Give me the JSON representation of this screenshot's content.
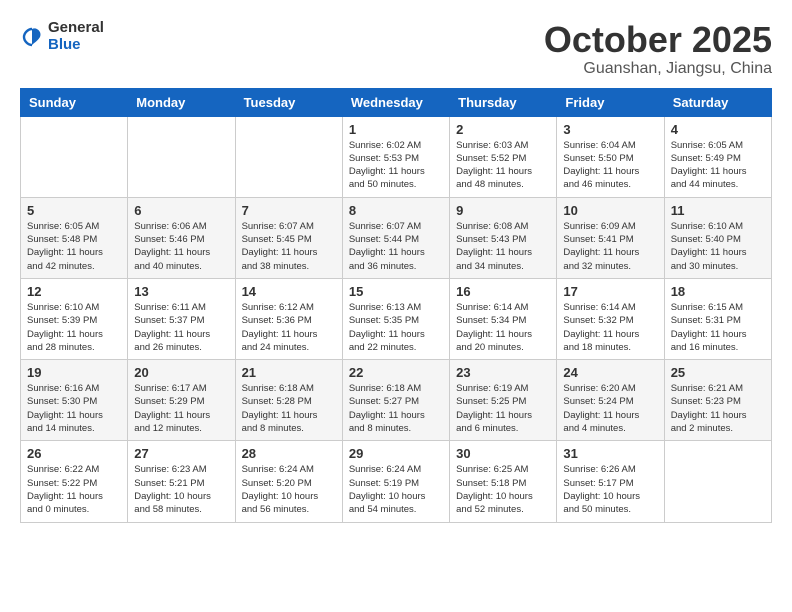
{
  "logo": {
    "general": "General",
    "blue": "Blue"
  },
  "title": "October 2025",
  "location": "Guanshan, Jiangsu, China",
  "headers": [
    "Sunday",
    "Monday",
    "Tuesday",
    "Wednesday",
    "Thursday",
    "Friday",
    "Saturday"
  ],
  "weeks": [
    [
      {
        "day": "",
        "sunrise": "",
        "sunset": "",
        "daylight": ""
      },
      {
        "day": "",
        "sunrise": "",
        "sunset": "",
        "daylight": ""
      },
      {
        "day": "",
        "sunrise": "",
        "sunset": "",
        "daylight": ""
      },
      {
        "day": "1",
        "sunrise": "Sunrise: 6:02 AM",
        "sunset": "Sunset: 5:53 PM",
        "daylight": "Daylight: 11 hours and 50 minutes."
      },
      {
        "day": "2",
        "sunrise": "Sunrise: 6:03 AM",
        "sunset": "Sunset: 5:52 PM",
        "daylight": "Daylight: 11 hours and 48 minutes."
      },
      {
        "day": "3",
        "sunrise": "Sunrise: 6:04 AM",
        "sunset": "Sunset: 5:50 PM",
        "daylight": "Daylight: 11 hours and 46 minutes."
      },
      {
        "day": "4",
        "sunrise": "Sunrise: 6:05 AM",
        "sunset": "Sunset: 5:49 PM",
        "daylight": "Daylight: 11 hours and 44 minutes."
      }
    ],
    [
      {
        "day": "5",
        "sunrise": "Sunrise: 6:05 AM",
        "sunset": "Sunset: 5:48 PM",
        "daylight": "Daylight: 11 hours and 42 minutes."
      },
      {
        "day": "6",
        "sunrise": "Sunrise: 6:06 AM",
        "sunset": "Sunset: 5:46 PM",
        "daylight": "Daylight: 11 hours and 40 minutes."
      },
      {
        "day": "7",
        "sunrise": "Sunrise: 6:07 AM",
        "sunset": "Sunset: 5:45 PM",
        "daylight": "Daylight: 11 hours and 38 minutes."
      },
      {
        "day": "8",
        "sunrise": "Sunrise: 6:07 AM",
        "sunset": "Sunset: 5:44 PM",
        "daylight": "Daylight: 11 hours and 36 minutes."
      },
      {
        "day": "9",
        "sunrise": "Sunrise: 6:08 AM",
        "sunset": "Sunset: 5:43 PM",
        "daylight": "Daylight: 11 hours and 34 minutes."
      },
      {
        "day": "10",
        "sunrise": "Sunrise: 6:09 AM",
        "sunset": "Sunset: 5:41 PM",
        "daylight": "Daylight: 11 hours and 32 minutes."
      },
      {
        "day": "11",
        "sunrise": "Sunrise: 6:10 AM",
        "sunset": "Sunset: 5:40 PM",
        "daylight": "Daylight: 11 hours and 30 minutes."
      }
    ],
    [
      {
        "day": "12",
        "sunrise": "Sunrise: 6:10 AM",
        "sunset": "Sunset: 5:39 PM",
        "daylight": "Daylight: 11 hours and 28 minutes."
      },
      {
        "day": "13",
        "sunrise": "Sunrise: 6:11 AM",
        "sunset": "Sunset: 5:37 PM",
        "daylight": "Daylight: 11 hours and 26 minutes."
      },
      {
        "day": "14",
        "sunrise": "Sunrise: 6:12 AM",
        "sunset": "Sunset: 5:36 PM",
        "daylight": "Daylight: 11 hours and 24 minutes."
      },
      {
        "day": "15",
        "sunrise": "Sunrise: 6:13 AM",
        "sunset": "Sunset: 5:35 PM",
        "daylight": "Daylight: 11 hours and 22 minutes."
      },
      {
        "day": "16",
        "sunrise": "Sunrise: 6:14 AM",
        "sunset": "Sunset: 5:34 PM",
        "daylight": "Daylight: 11 hours and 20 minutes."
      },
      {
        "day": "17",
        "sunrise": "Sunrise: 6:14 AM",
        "sunset": "Sunset: 5:32 PM",
        "daylight": "Daylight: 11 hours and 18 minutes."
      },
      {
        "day": "18",
        "sunrise": "Sunrise: 6:15 AM",
        "sunset": "Sunset: 5:31 PM",
        "daylight": "Daylight: 11 hours and 16 minutes."
      }
    ],
    [
      {
        "day": "19",
        "sunrise": "Sunrise: 6:16 AM",
        "sunset": "Sunset: 5:30 PM",
        "daylight": "Daylight: 11 hours and 14 minutes."
      },
      {
        "day": "20",
        "sunrise": "Sunrise: 6:17 AM",
        "sunset": "Sunset: 5:29 PM",
        "daylight": "Daylight: 11 hours and 12 minutes."
      },
      {
        "day": "21",
        "sunrise": "Sunrise: 6:18 AM",
        "sunset": "Sunset: 5:28 PM",
        "daylight": "Daylight: 11 hours and 8 minutes."
      },
      {
        "day": "22",
        "sunrise": "Sunrise: 6:18 AM",
        "sunset": "Sunset: 5:27 PM",
        "daylight": "Daylight: 11 hours and 8 minutes."
      },
      {
        "day": "23",
        "sunrise": "Sunrise: 6:19 AM",
        "sunset": "Sunset: 5:25 PM",
        "daylight": "Daylight: 11 hours and 6 minutes."
      },
      {
        "day": "24",
        "sunrise": "Sunrise: 6:20 AM",
        "sunset": "Sunset: 5:24 PM",
        "daylight": "Daylight: 11 hours and 4 minutes."
      },
      {
        "day": "25",
        "sunrise": "Sunrise: 6:21 AM",
        "sunset": "Sunset: 5:23 PM",
        "daylight": "Daylight: 11 hours and 2 minutes."
      }
    ],
    [
      {
        "day": "26",
        "sunrise": "Sunrise: 6:22 AM",
        "sunset": "Sunset: 5:22 PM",
        "daylight": "Daylight: 11 hours and 0 minutes."
      },
      {
        "day": "27",
        "sunrise": "Sunrise: 6:23 AM",
        "sunset": "Sunset: 5:21 PM",
        "daylight": "Daylight: 10 hours and 58 minutes."
      },
      {
        "day": "28",
        "sunrise": "Sunrise: 6:24 AM",
        "sunset": "Sunset: 5:20 PM",
        "daylight": "Daylight: 10 hours and 56 minutes."
      },
      {
        "day": "29",
        "sunrise": "Sunrise: 6:24 AM",
        "sunset": "Sunset: 5:19 PM",
        "daylight": "Daylight: 10 hours and 54 minutes."
      },
      {
        "day": "30",
        "sunrise": "Sunrise: 6:25 AM",
        "sunset": "Sunset: 5:18 PM",
        "daylight": "Daylight: 10 hours and 52 minutes."
      },
      {
        "day": "31",
        "sunrise": "Sunrise: 6:26 AM",
        "sunset": "Sunset: 5:17 PM",
        "daylight": "Daylight: 10 hours and 50 minutes."
      },
      {
        "day": "",
        "sunrise": "",
        "sunset": "",
        "daylight": ""
      }
    ]
  ]
}
